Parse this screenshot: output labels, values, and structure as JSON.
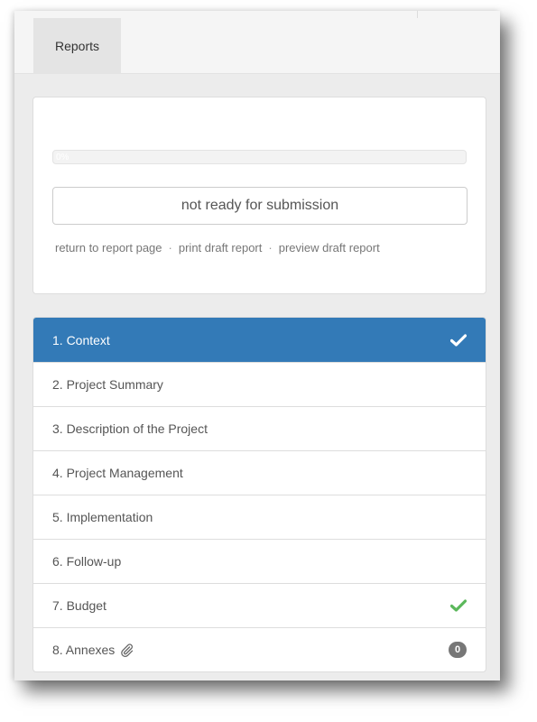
{
  "header": {
    "tab_label": "Reports"
  },
  "report_panel": {
    "progress": {
      "percent": 0,
      "label": "0%",
      "fill_color": "#337ab7"
    },
    "status_text": "not ready for submission",
    "links": [
      {
        "label": "return to report page"
      },
      {
        "label": "print draft report"
      },
      {
        "label": "preview draft report"
      }
    ],
    "link_separator": "·"
  },
  "sections": {
    "items": [
      {
        "label": "1. Context",
        "active": true,
        "completed": true,
        "icon": "check-icon"
      },
      {
        "label": "2. Project Summary",
        "active": false,
        "completed": false
      },
      {
        "label": "3. Description of the Project",
        "active": false,
        "completed": false
      },
      {
        "label": "4. Project Management",
        "active": false,
        "completed": false
      },
      {
        "label": "5. Implementation",
        "active": false,
        "completed": false
      },
      {
        "label": "6. Follow-up",
        "active": false,
        "completed": false
      },
      {
        "label": "7. Budget",
        "active": false,
        "completed": true,
        "icon": "check-icon"
      },
      {
        "label": "8. Annexes",
        "active": false,
        "completed": false,
        "icon": "paperclip-icon",
        "badge": "0"
      }
    ]
  },
  "colors": {
    "active_background": "#337ab7",
    "check_on_active": "#ffffff",
    "check_completed": "#5cb85c",
    "badge_background": "#777777"
  }
}
